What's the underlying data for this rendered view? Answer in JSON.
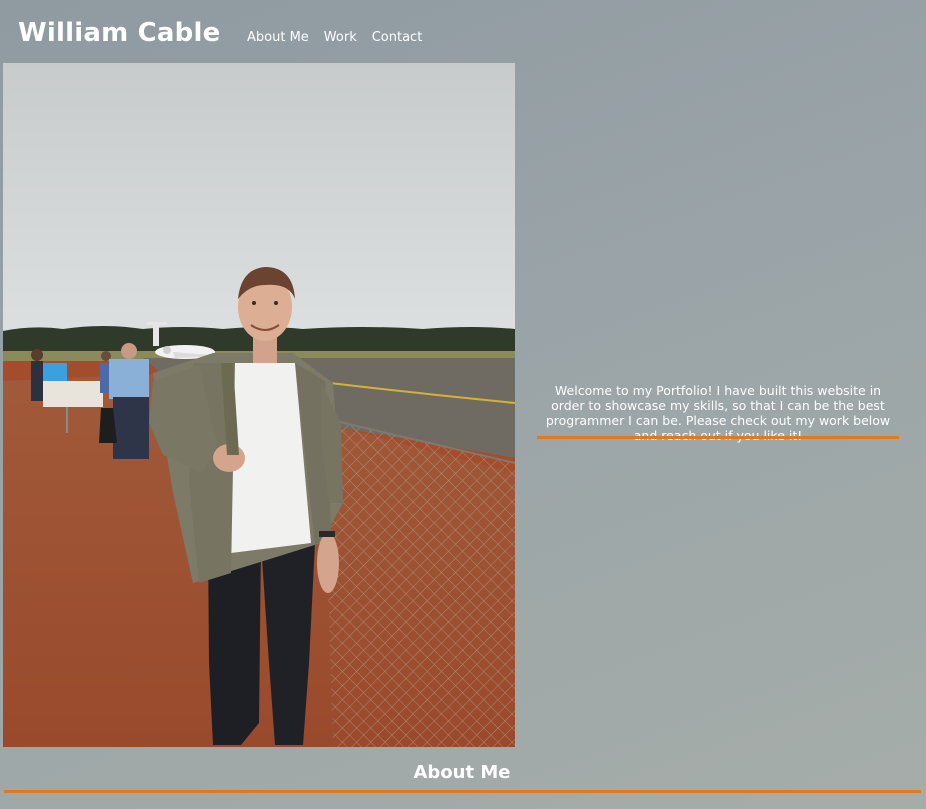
{
  "header": {
    "title": "William Cable",
    "nav": [
      {
        "label": "About Me"
      },
      {
        "label": "Work"
      },
      {
        "label": "Contact"
      }
    ]
  },
  "hero": {
    "welcome_text": "Welcome to my Portfolio! I have built this website in order to showcase my skills, so that I can be the best programmer I can be. Please check out my work below and reach out if you like it!"
  },
  "about": {
    "heading": "About Me"
  },
  "colors": {
    "accent": "#e07a1f",
    "text": "#ffffff"
  }
}
